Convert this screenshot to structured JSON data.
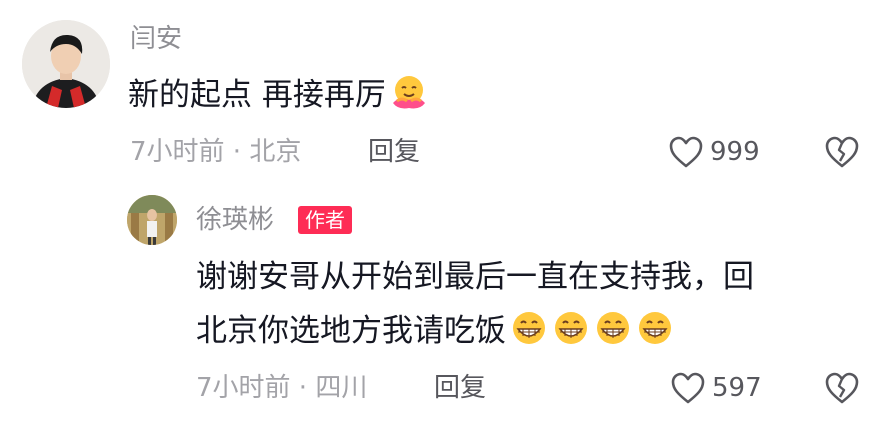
{
  "comment": {
    "username": "闫安",
    "text": "新的起点 再接再厉",
    "emoji": "hug-face-emoji",
    "meta": "7小时前 · 北京",
    "reply_label": "回复",
    "like_count": "999"
  },
  "reply": {
    "username": "徐瑛彬",
    "author_tag": "作者",
    "text_line1": "谢谢安哥从开始到最后一直在支持我，回",
    "text_line2": "北京你选地方我请吃饭",
    "emoji": "grinning-face-emoji",
    "emoji_count": 4,
    "meta": "7小时前 · 四川",
    "reply_label": "回复",
    "like_count": "597"
  },
  "colors": {
    "author_tag": "#fe2c55",
    "text_primary": "#161823",
    "text_secondary": "#a3a3a8",
    "icon": "#57575d"
  }
}
